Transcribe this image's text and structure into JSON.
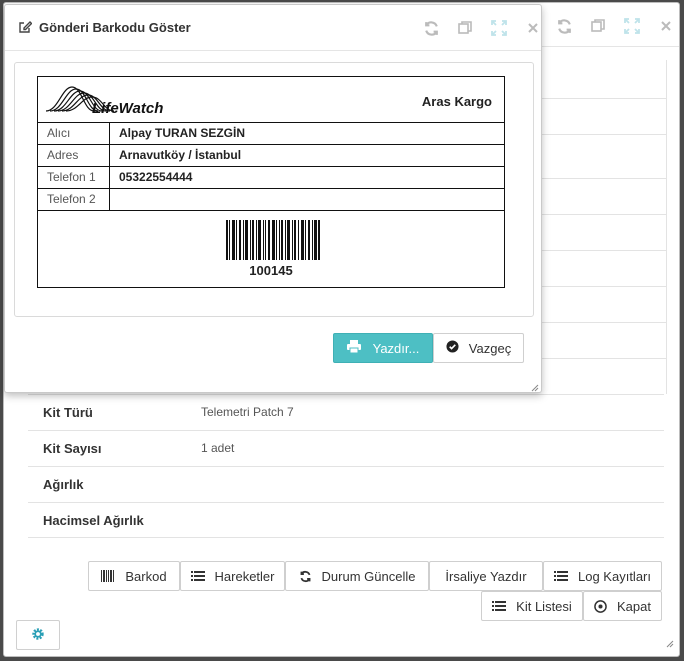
{
  "modal": {
    "title": "Gönderi Barkodu Göster",
    "label": {
      "logo_text": "LifeWatch",
      "carrier": "Aras Kargo",
      "rows": [
        {
          "key": "Alıcı",
          "value": "Alpay TURAN SEZGİN"
        },
        {
          "key": "Adres",
          "value": "Arnavutköy / İstanbul"
        },
        {
          "key": "Telefon 1",
          "value": "05322554444"
        },
        {
          "key": "Telefon 2",
          "value": ""
        }
      ],
      "barcode_number": "100145"
    },
    "print_label": "Yazdır...",
    "cancel_label": "Vazgeç"
  },
  "details": [
    {
      "key": "Kit Türü",
      "value": "Telemetri Patch 7"
    },
    {
      "key": "Kit Sayısı",
      "value": "1 adet"
    },
    {
      "key": "Ağırlık",
      "value": ""
    },
    {
      "key": "Hacimsel Ağırlık",
      "value": ""
    }
  ],
  "toolbar": {
    "barkod": "Barkod",
    "hareketler": "Hareketler",
    "durum_guncelle": "Durum Güncelle",
    "irsaliye_yazdir": "İrsaliye Yazdır",
    "log_kayitlari": "Log Kayıtları",
    "kit_listesi": "Kit Listesi",
    "kapat": "Kapat"
  },
  "colors": {
    "accent": "#4dbfc4",
    "gear": "#2a9fb6"
  }
}
